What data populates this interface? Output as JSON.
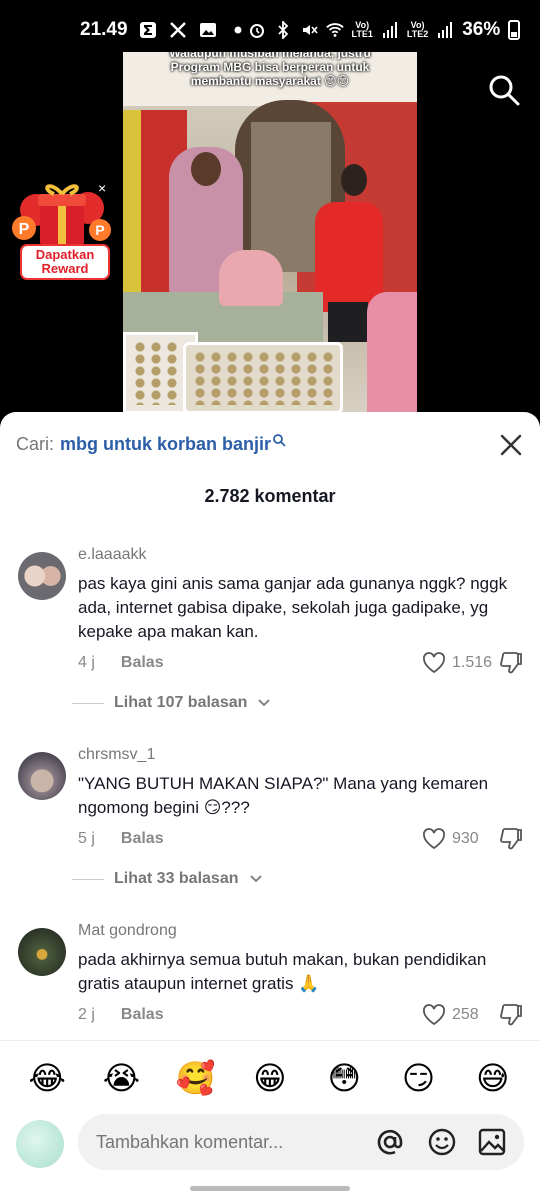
{
  "status_bar": {
    "time": "21.49",
    "battery": "36%",
    "lte1": "Vo)\nLTE1",
    "lte2": "Vo)\nLTE2"
  },
  "video": {
    "caption": "Walaupun musibah melanda, justru Program MBG bisa berperan untuk membantu masyarakat 😊😊"
  },
  "reward": {
    "label": "Dapatkan Reward"
  },
  "sheet": {
    "search_prefix": "Cari:",
    "search_query": "mbg untuk korban banjir",
    "comment_count": "2.782 komentar"
  },
  "comments": [
    {
      "username": "e.laaaakk",
      "text": "pas kaya gini anis sama ganjar ada gunanya nggk? nggk ada, internet gabisa dipake, sekolah juga gadipake, yg kepake apa makan kan.",
      "age": "4 j",
      "reply": "Balas",
      "likes": "1.516",
      "view_replies": "Lihat 107 balasan"
    },
    {
      "username": "chrsmsv_1",
      "text": "\"YANG BUTUH MAKAN SIAPA?\" Mana yang kemaren ngomong begini 😏???",
      "age": "5 j",
      "reply": "Balas",
      "likes": "930",
      "view_replies": "Lihat 33 balasan"
    },
    {
      "username": "Mat gondrong",
      "text": "pada akhirnya semua butuh makan, bukan pendidikan gratis ataupun internet gratis 🙏",
      "age": "2 j",
      "reply": "Balas",
      "likes": "258"
    }
  ],
  "emoji_bar": [
    "😂",
    "😭",
    "🥰",
    "😁",
    "😳",
    "😏",
    "😅"
  ],
  "composer": {
    "placeholder": "Tambahkan komentar..."
  },
  "icons": {
    "search": "search-icon",
    "close": "close-icon",
    "heart": "heart-icon",
    "dislike": "dislike-icon",
    "mention": "at-icon",
    "emoji": "smile-icon",
    "image": "image-icon"
  }
}
